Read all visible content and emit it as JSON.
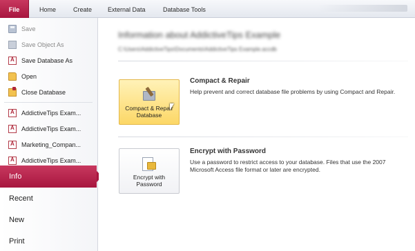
{
  "ribbon": {
    "tabs": [
      "File",
      "Home",
      "Create",
      "External Data",
      "Database Tools"
    ]
  },
  "backstage": {
    "commands": [
      {
        "label": "Save",
        "icon": "save-icon",
        "enabled": false
      },
      {
        "label": "Save Object As",
        "icon": "save-object-icon",
        "enabled": false
      },
      {
        "label": "Save Database As",
        "icon": "access-db-icon",
        "enabled": true
      },
      {
        "label": "Open",
        "icon": "folder-open-icon",
        "enabled": true
      },
      {
        "label": "Close Database",
        "icon": "close-database-icon",
        "enabled": true
      }
    ],
    "recent_files": [
      "AddictiveTips Exam...",
      "AddictiveTips Exam...",
      "Marketing_Compan...",
      "AddictiveTips Exam..."
    ],
    "tabs": [
      {
        "label": "Info",
        "active": true
      },
      {
        "label": "Recent",
        "active": false
      },
      {
        "label": "New",
        "active": false
      },
      {
        "label": "Print",
        "active": false
      }
    ]
  },
  "info": {
    "title": "Information about AddictiveTips Example",
    "path": "C:\\Users\\AddictiveTips\\Documents\\AddictiveTips Example.accdb"
  },
  "compact": {
    "button_label": "Compact & Repair Database",
    "heading": "Compact & Repair",
    "description": "Help prevent and correct database file problems by using Compact and Repair."
  },
  "encrypt": {
    "button_label": "Encrypt with Password",
    "heading": "Encrypt with Password",
    "description": "Use a password to restrict access to your database. Files that use the 2007 Microsoft Access file format or later are encrypted."
  },
  "colors": {
    "accent": "#b3204a",
    "hover_fill": "#fcd766",
    "hover_border": "#e3b74a"
  }
}
